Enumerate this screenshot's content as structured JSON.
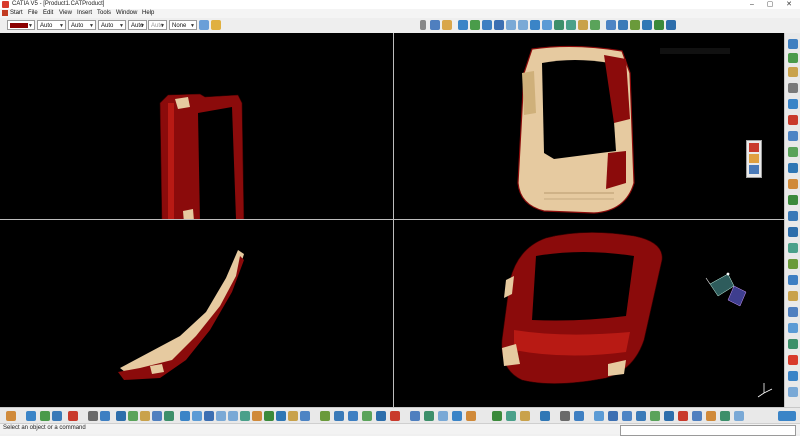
{
  "window": {
    "title": "CATIA V5 - [Product1.CATProduct]",
    "controls": {
      "minimize": "–",
      "restore": "▢",
      "close": "✕"
    }
  },
  "menu": {
    "items": [
      {
        "label": "Start"
      },
      {
        "label": "File"
      },
      {
        "label": "Edit"
      },
      {
        "label": "View"
      },
      {
        "label": "Insert"
      },
      {
        "label": "Tools"
      },
      {
        "label": "Window"
      },
      {
        "label": "Help"
      }
    ]
  },
  "graphic_properties": {
    "color_swatch": "#8b0000",
    "line_type": "Auto",
    "line_thickness": "Auto",
    "point_symbol": "Auto",
    "render_style": "Auto",
    "layer_disabled": "Auto",
    "layer": "None"
  },
  "status": {
    "message": "Select an object or a command",
    "command_value": ""
  },
  "colors": {
    "part_red": "#8b0b0b",
    "part_red_light": "#b81a14",
    "part_beige": "#e6caa0",
    "viewport_bg": "#000000",
    "divider": "#bdbdbd"
  }
}
